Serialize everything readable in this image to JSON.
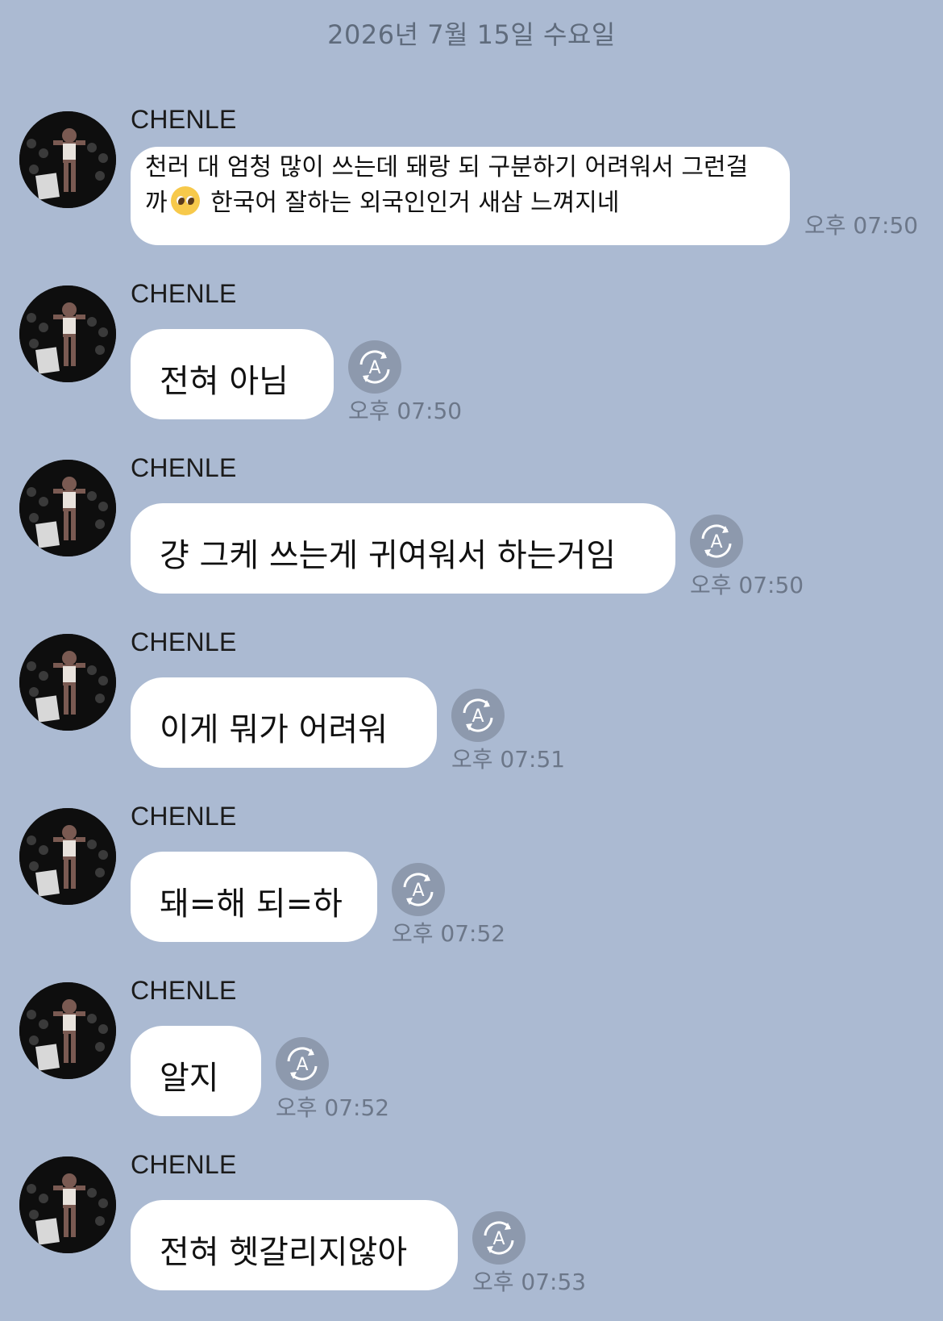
{
  "date_header": "2026년 7월 15일 수요일",
  "messages": [
    {
      "sender": "CHENLE",
      "text_line1": "천러 대 엄청 많이 쓰는데 돼랑 되 구분하기 어려워서 그런걸",
      "text_line2_start": "까",
      "emoji": "pleading-face-emoji",
      "text_line2_end": " 한국어 잘하는 외국인인거 새삼 느껴지네",
      "time": "오후 07:50"
    },
    {
      "sender": "CHENLE",
      "text": "전혀 아님",
      "time": "오후 07:50",
      "translate_icon": "translate-icon"
    },
    {
      "sender": "CHENLE",
      "text": "걍 그케 쓰는게 귀여워서 하는거임",
      "time": "오후 07:50",
      "translate_icon": "translate-icon"
    },
    {
      "sender": "CHENLE",
      "text": "이게 뭐가 어려워",
      "time": "오후 07:51",
      "translate_icon": "translate-icon"
    },
    {
      "sender": "CHENLE",
      "text": "돼=해 되=하",
      "time": "오후 07:52",
      "translate_icon": "translate-icon"
    },
    {
      "sender": "CHENLE",
      "text": "알지",
      "time": "오후 07:52",
      "translate_icon": "translate-icon"
    },
    {
      "sender": "CHENLE",
      "text": "전혀 헷갈리지않아",
      "time": "오후 07:53",
      "translate_icon": "translate-icon"
    }
  ],
  "colors": {
    "background": "#abbad2",
    "bubble": "#ffffff",
    "translate_button": "#8d99ad",
    "timestamp": "#6c7789"
  }
}
